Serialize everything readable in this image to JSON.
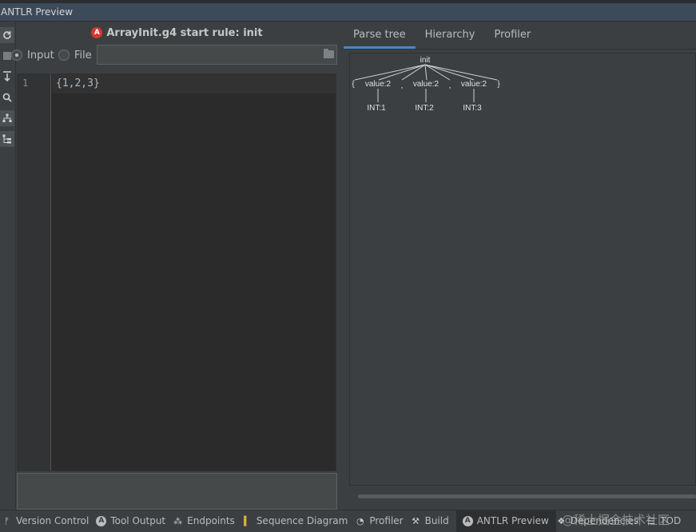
{
  "window": {
    "title": "ANTLR Preview"
  },
  "toolbar": {
    "icons": [
      "refresh-icon",
      "stop-icon",
      "export-icon",
      "search-icon",
      "tree-icon",
      "hierarchy-icon"
    ]
  },
  "left": {
    "header": {
      "badge": "A",
      "title": "ArrayInit.g4 start rule: init"
    },
    "source": {
      "input_label": "Input",
      "file_label": "File",
      "selected": "Input",
      "file_value": ""
    },
    "editor": {
      "line_number": "1",
      "code": "{1,2,3}"
    }
  },
  "right": {
    "tabs": [
      "Parse tree",
      "Hierarchy",
      "Profiler"
    ],
    "selected_tab": "Parse tree",
    "tree": {
      "root": "init",
      "children": [
        "{",
        "value:2",
        ",",
        "value:2",
        ",",
        "value:2",
        "}"
      ],
      "leaves": [
        "INT:1",
        "INT:2",
        "INT:3"
      ]
    }
  },
  "statusbar": {
    "items": [
      {
        "label": "Version Control",
        "icon": "version-control-icon"
      },
      {
        "label": "Tool Output",
        "icon": "antlr-icon"
      },
      {
        "label": "Endpoints",
        "icon": "endpoints-icon"
      },
      {
        "label": "Sequence Diagram",
        "icon": "sequence-diagram-icon"
      },
      {
        "label": "Profiler",
        "icon": "profiler-icon"
      },
      {
        "label": "Build",
        "icon": "hammer-icon"
      },
      {
        "label": "ANTLR Preview",
        "icon": "antlr-icon"
      },
      {
        "label": "Dependencies",
        "icon": "dependencies-icon"
      },
      {
        "label": "TOD",
        "icon": "list-icon"
      }
    ],
    "selected": "ANTLR Preview"
  },
  "watermark": "@稀土掘金技术社区"
}
